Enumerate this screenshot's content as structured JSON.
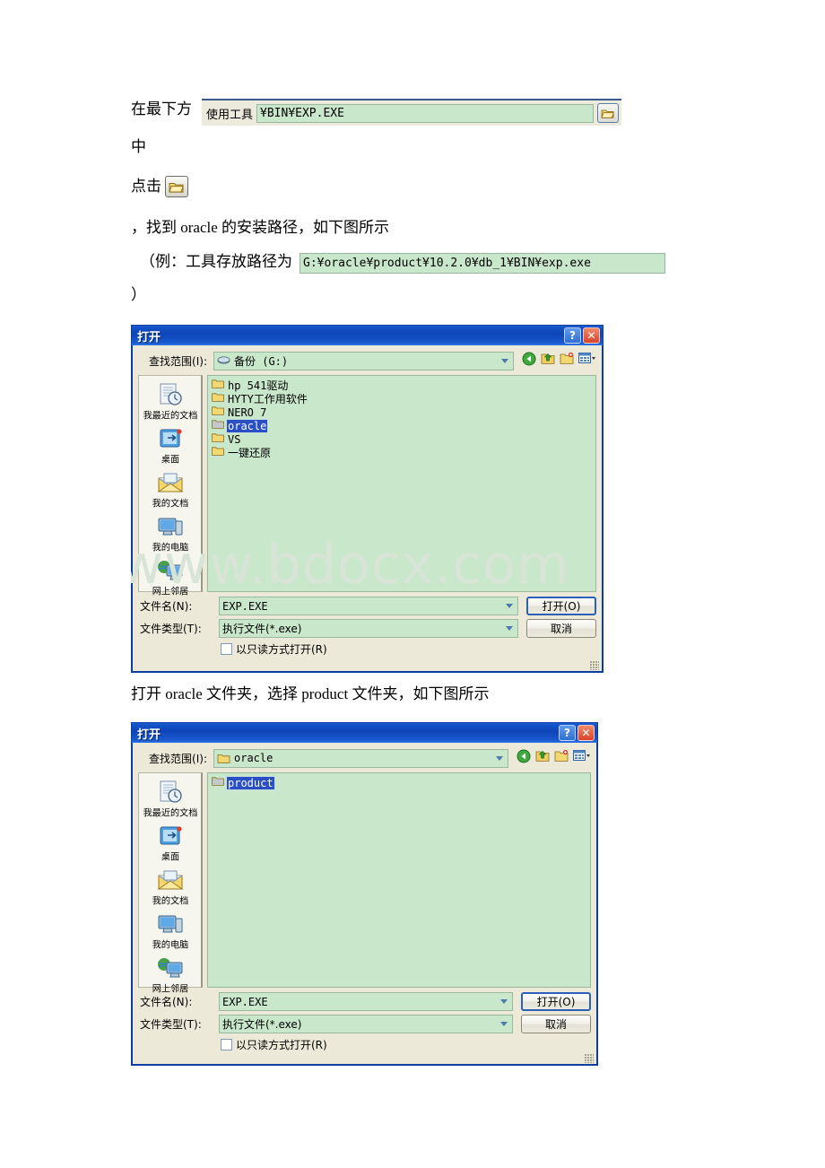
{
  "document": {
    "line1": "在最下方",
    "line2": "中",
    "line3_prefix": "点击",
    "line4": "，找到 oracle 的安装路径，如下图所示",
    "line5_prefix": "（例：工具存放路径为",
    "line6": "）",
    "between_dialogs": "打开 oracle 文件夹，选择 product 文件夹，如下图所示"
  },
  "tool_strip": {
    "label": "使用工具",
    "value": "¥BIN¥EXP.EXE",
    "browse_icon": "folder-open-icon"
  },
  "path_field": {
    "value": "G:¥oracle¥product¥10.2.0¥db_1¥BIN¥exp.exe"
  },
  "watermark": {
    "text": "www.bdocx.com",
    "color": "#d8e5d6"
  },
  "dialog1": {
    "title": "打开",
    "help_button": "?",
    "close_button": "✕",
    "lookin": {
      "label": "查找范围(I):",
      "value": "备份 (G:)",
      "icon": "drive-icon"
    },
    "toolbar": [
      {
        "name": "back-icon",
        "label": "后退"
      },
      {
        "name": "up-folder-icon",
        "label": "向上一级"
      },
      {
        "name": "new-folder-icon",
        "label": "新建文件夹"
      },
      {
        "name": "views-icon",
        "label": "查看"
      }
    ],
    "places": [
      {
        "label": "我最近的文档",
        "icon": "recent-documents-icon"
      },
      {
        "label": "桌面",
        "icon": "desktop-icon"
      },
      {
        "label": "我的文档",
        "icon": "my-documents-icon"
      },
      {
        "label": "我的电脑",
        "icon": "my-computer-icon"
      },
      {
        "label": "网上邻居",
        "icon": "network-icon"
      }
    ],
    "files": [
      {
        "name": "hp 541驱动",
        "selected": false
      },
      {
        "name": "HYTY工作用软件",
        "selected": false
      },
      {
        "name": "NERO 7",
        "selected": false
      },
      {
        "name": "oracle",
        "selected": true
      },
      {
        "name": "VS",
        "selected": false
      },
      {
        "name": "一键还原",
        "selected": false
      }
    ],
    "filename": {
      "label": "文件名(N):",
      "value": "EXP.EXE"
    },
    "filetype": {
      "label": "文件类型(T):",
      "value": "执行文件(*.exe)"
    },
    "readonly": {
      "label": "以只读方式打开(R)",
      "checked": false
    },
    "open_button": "打开(O)",
    "cancel_button": "取消"
  },
  "dialog2": {
    "title": "打开",
    "help_button": "?",
    "close_button": "✕",
    "lookin": {
      "label": "查找范围(I):",
      "value": "oracle",
      "icon": "folder-icon"
    },
    "toolbar": [
      {
        "name": "back-icon",
        "label": "后退"
      },
      {
        "name": "up-folder-icon",
        "label": "向上一级"
      },
      {
        "name": "new-folder-icon",
        "label": "新建文件夹"
      },
      {
        "name": "views-icon",
        "label": "查看"
      }
    ],
    "places": [
      {
        "label": "我最近的文档",
        "icon": "recent-documents-icon"
      },
      {
        "label": "桌面",
        "icon": "desktop-icon"
      },
      {
        "label": "我的文档",
        "icon": "my-documents-icon"
      },
      {
        "label": "我的电脑",
        "icon": "my-computer-icon"
      },
      {
        "label": "网上邻居",
        "icon": "network-icon"
      }
    ],
    "files": [
      {
        "name": "product",
        "selected": true
      }
    ],
    "filename": {
      "label": "文件名(N):",
      "value": "EXP.EXE"
    },
    "filetype": {
      "label": "文件类型(T):",
      "value": "执行文件(*.exe)"
    },
    "readonly": {
      "label": "以只读方式打开(R)",
      "checked": false
    },
    "open_button": "打开(O)",
    "cancel_button": "取消"
  },
  "colors": {
    "title_blue": "#0b3e9e",
    "field_green": "#c9e7cb",
    "dialog_face": "#ece9d8",
    "selection_blue": "#2a4fc4"
  }
}
